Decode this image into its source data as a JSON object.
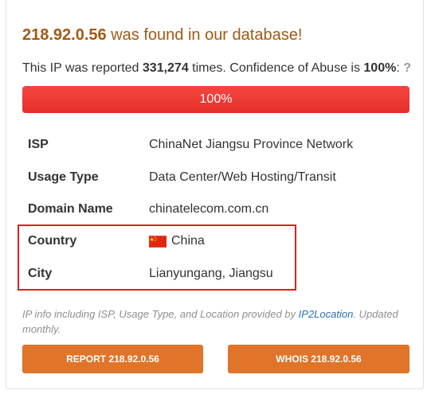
{
  "header": {
    "ip": "218.92.0.56",
    "found_text": " was found in our database!"
  },
  "report": {
    "prefix": "This IP was reported ",
    "count": "331,274",
    "middle": " times. Confidence of Abuse is ",
    "confidence": "100%",
    "suffix": ": ",
    "help": "?"
  },
  "abuse_bar": {
    "label": "100%",
    "fill_percent": 100,
    "color": "#f5453f"
  },
  "info_rows": [
    {
      "key": "ISP",
      "value": "ChinaNet Jiangsu Province Network"
    },
    {
      "key": "Usage Type",
      "value": "Data Center/Web Hosting/Transit"
    },
    {
      "key": "Domain Name",
      "value": "chinatelecom.com.cn"
    },
    {
      "key": "Country",
      "value": "China",
      "icon": "china-flag-icon"
    },
    {
      "key": "City",
      "value": "Lianyungang, Jiangsu"
    }
  ],
  "credit": {
    "prefix": "IP info including ISP, Usage Type, and Location provided by ",
    "link": "IP2Location",
    "suffix": ". Updated monthly."
  },
  "buttons": {
    "report": "REPORT 218.92.0.56",
    "whois": "WHOIS 218.92.0.56"
  },
  "colors": {
    "title": "#a15a14",
    "bar": "#f5453f",
    "button": "#e07428",
    "highlight": "#e02020",
    "link": "#2a6fb5"
  }
}
